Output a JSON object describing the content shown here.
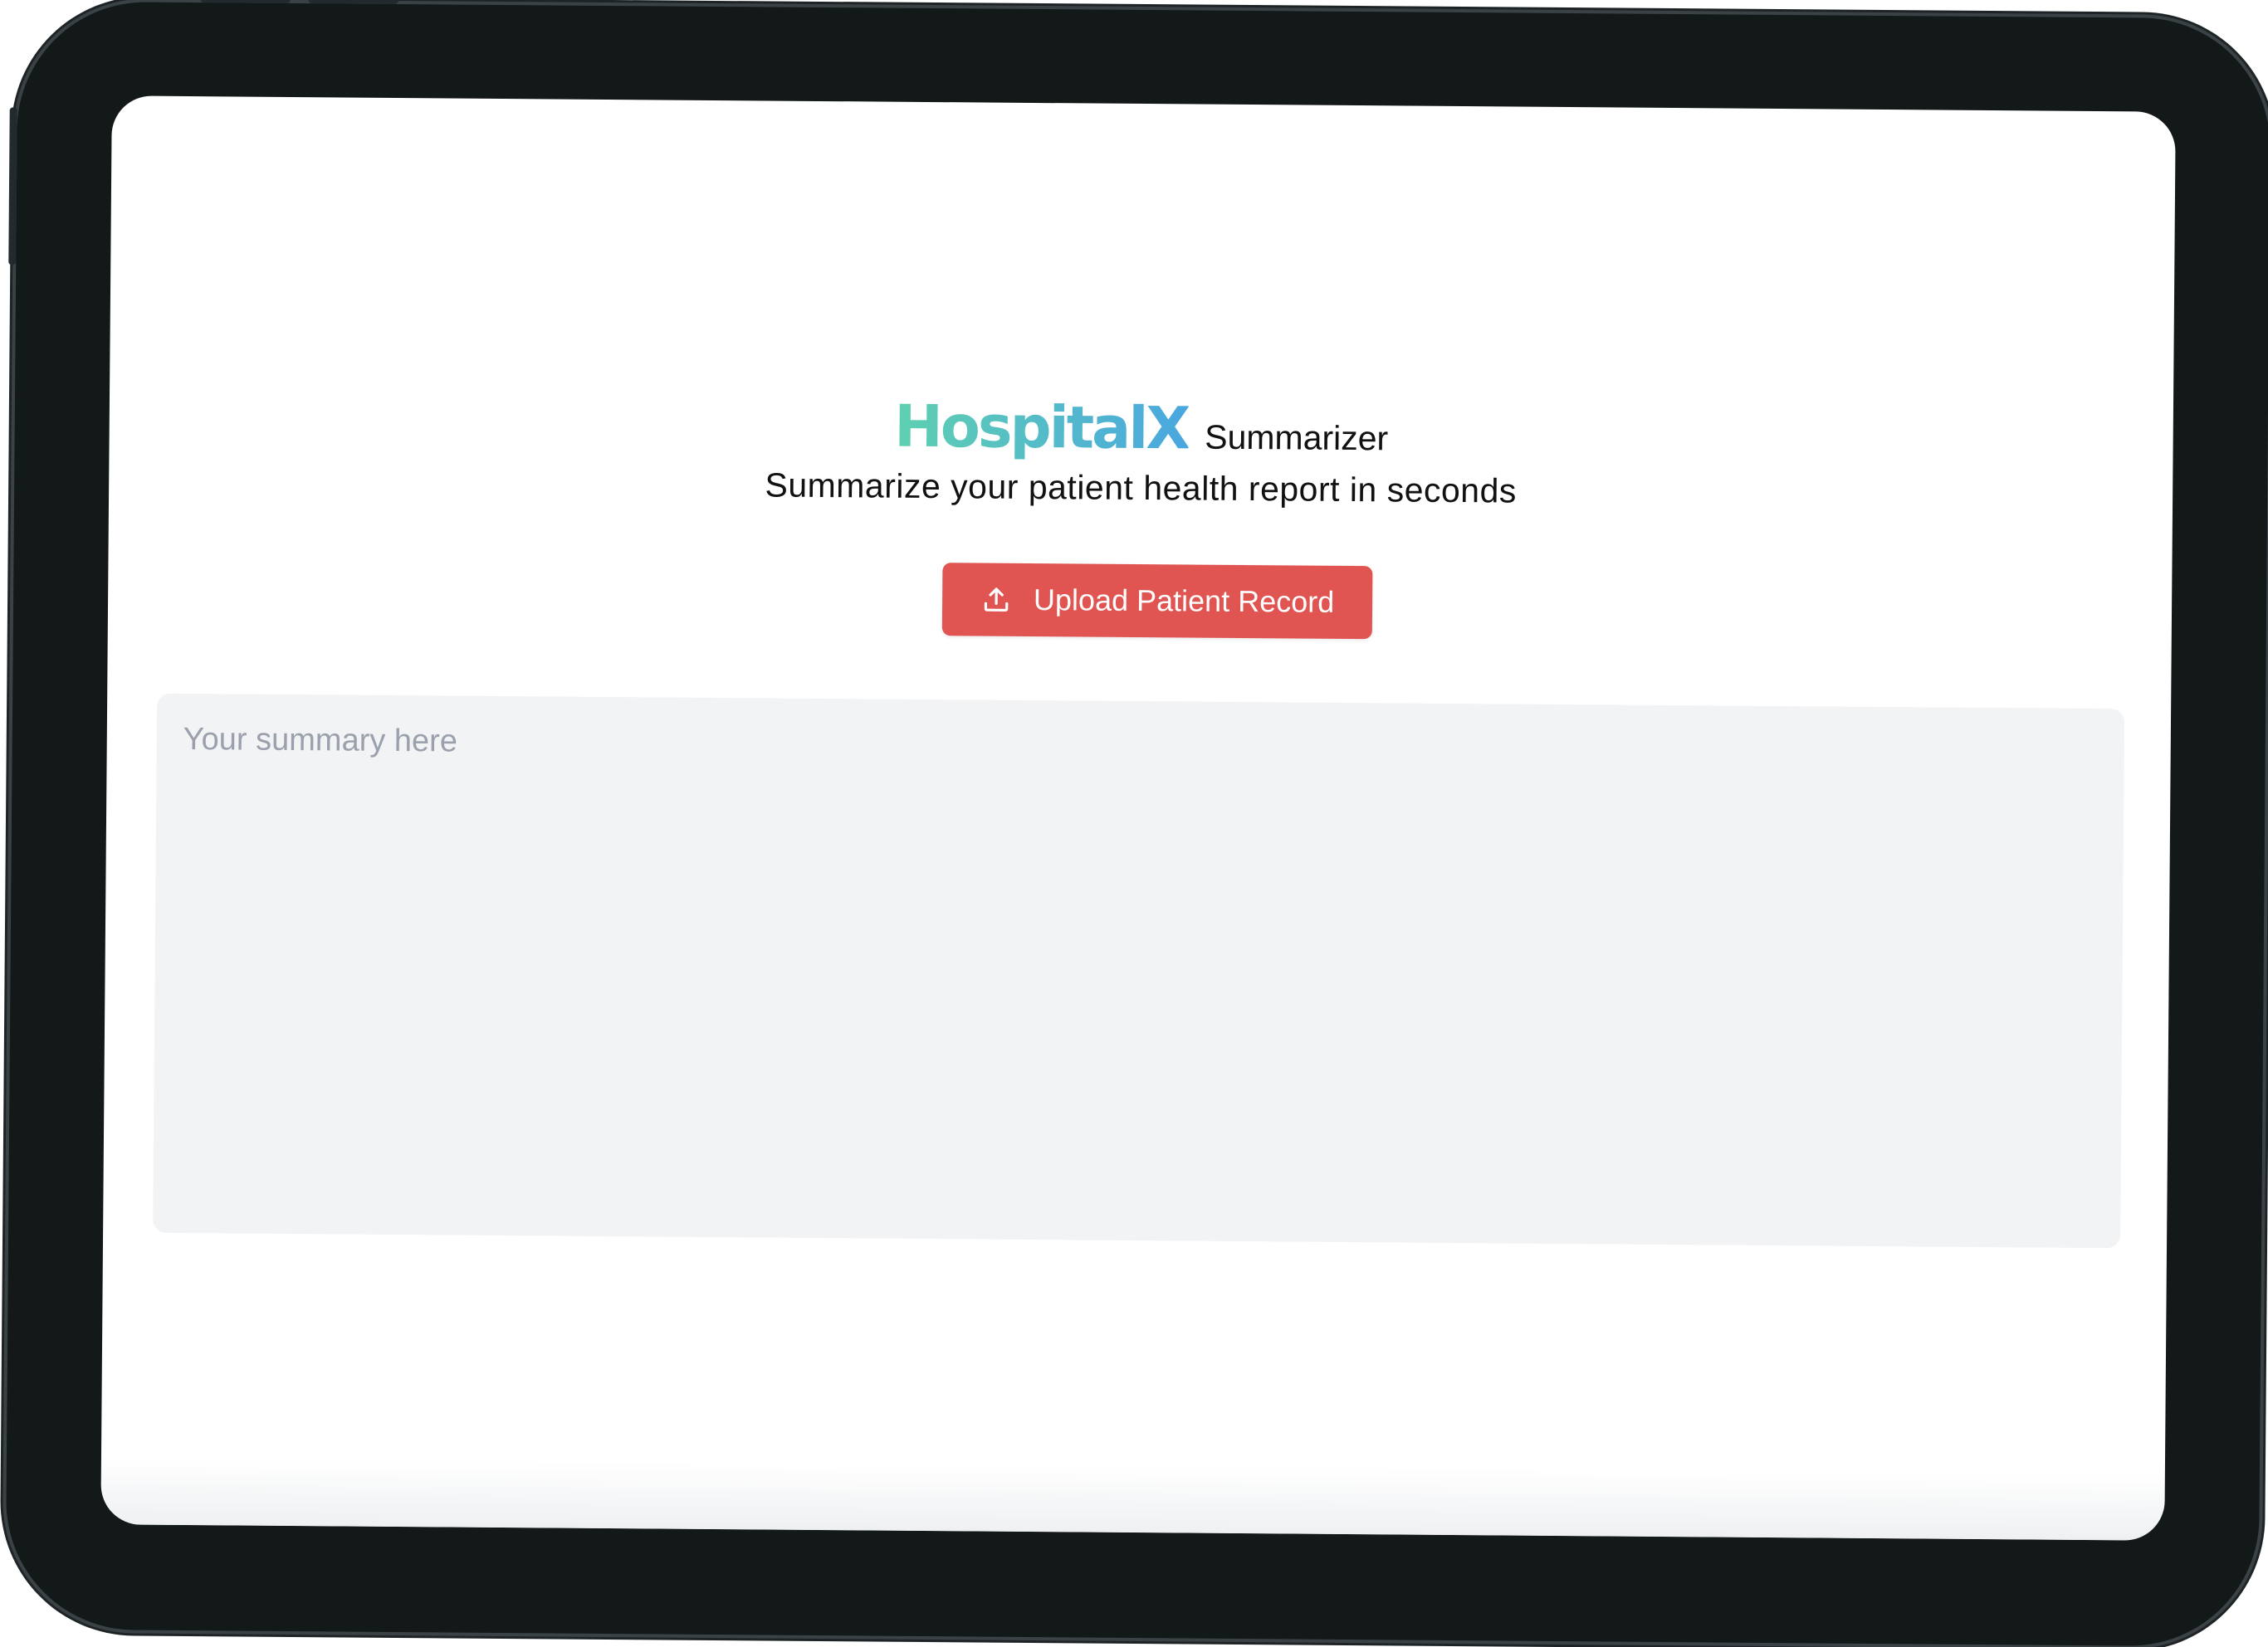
{
  "brand": {
    "logo_text": "HospitalX",
    "app_name": "Summarizer",
    "tagline": "Summarize your patient health report in seconds"
  },
  "actions": {
    "upload_label": "Upload Patient Record",
    "upload_icon": "upload-icon"
  },
  "summary": {
    "placeholder": "Your summary here",
    "value": ""
  },
  "colors": {
    "accent": "#e05552",
    "logo_gradient_start": "#5fd0b0",
    "logo_gradient_end": "#4aa7e0",
    "summary_background": "#f2f3f5",
    "device_frame": "#131819"
  }
}
